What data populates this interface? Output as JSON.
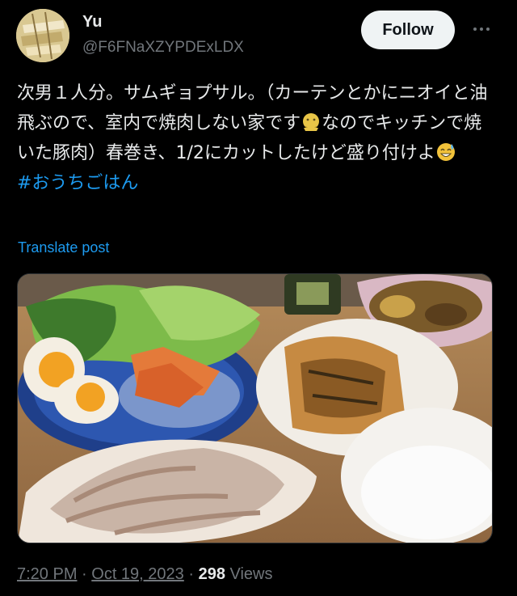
{
  "author": {
    "name": "Yu",
    "handle": "@F6FNaXZYPDExLDX",
    "follow_label": "Follow"
  },
  "post": {
    "text_part1": "次男１人分。サムギョプサル。（カーテンとかにニオイと油飛ぶので、室内で焼肉しない家です",
    "text_part2": "なのでキッチンで焼いた豚肉）春巻き、1/2にカットしたけど盛り付けよ",
    "hashtag": "#おうちごはん",
    "translate_label": "Translate post",
    "emojis": [
      "nauseated-face-emoji",
      "sweat-smile-emoji"
    ]
  },
  "meta": {
    "time": "7:20 PM",
    "separator": " · ",
    "date": "Oct 19, 2023",
    "separator2": " · ",
    "views_count": "298",
    "views_label": " Views"
  },
  "colors": {
    "background": "#000000",
    "text": "#e7e9ea",
    "secondary": "#71767b",
    "link": "#1d9bf0",
    "follow_bg": "#eff3f4"
  }
}
